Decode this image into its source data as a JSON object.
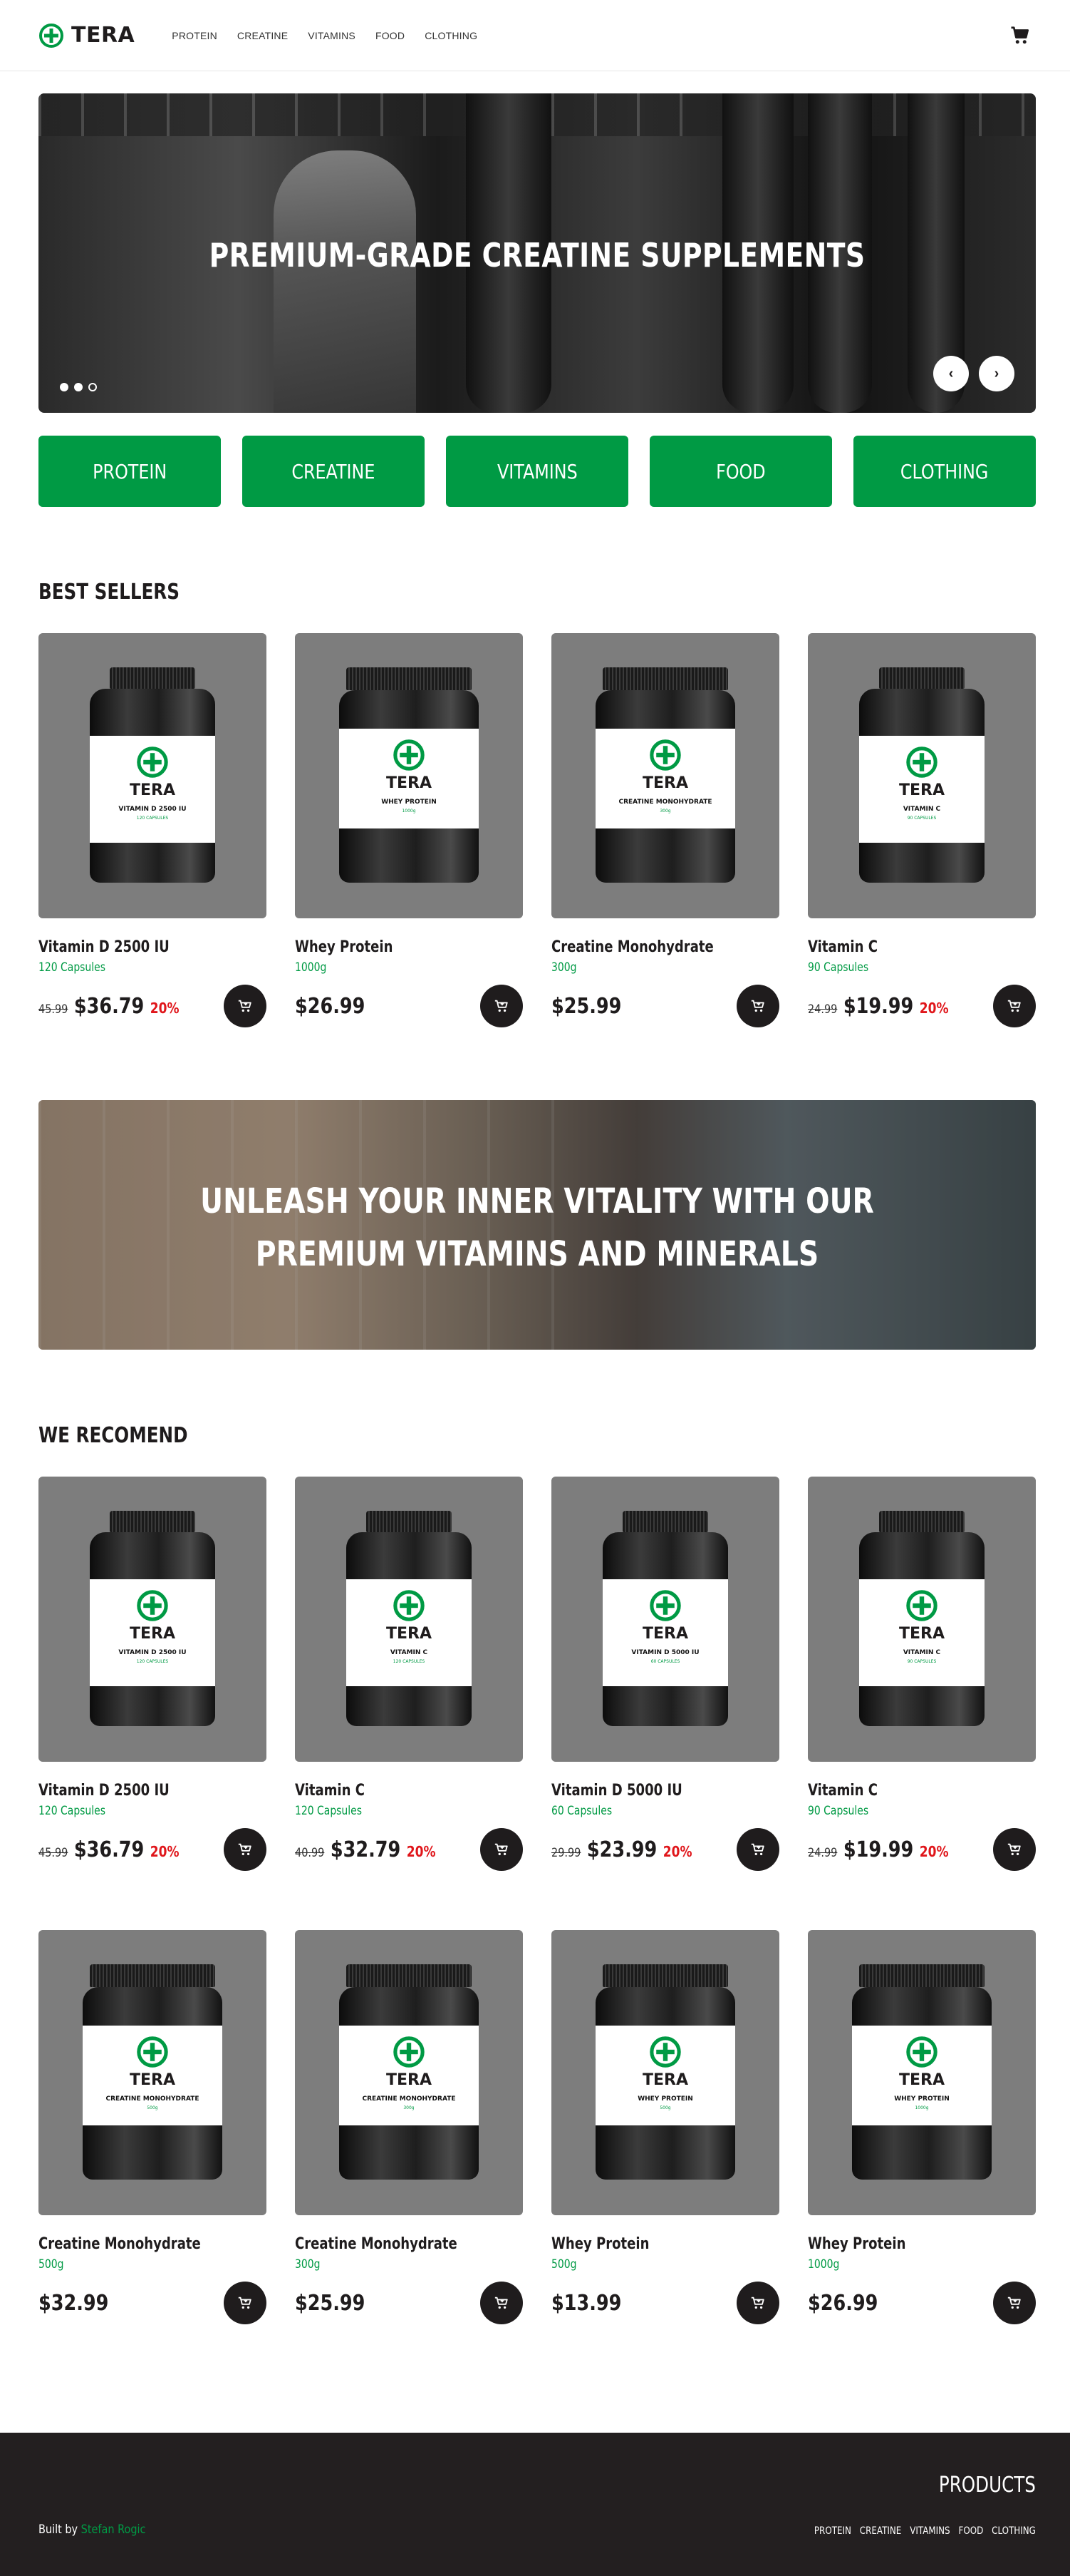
{
  "brand": {
    "name": "TERA",
    "accent": "#009a44",
    "dark": "#1f1c1d",
    "sale_color": "#e0161b"
  },
  "nav": {
    "items": [
      "PROTEIN",
      "CREATINE",
      "VITAMINS",
      "FOOD",
      "CLOTHING"
    ]
  },
  "hero": {
    "title": "PREMIUM-GRADE CREATINE SUPPLEMENTS",
    "slides_count": 3,
    "active_slide": 2,
    "prev_icon": "chevron-left-icon",
    "next_icon": "chevron-right-icon"
  },
  "categories": [
    "PROTEIN",
    "CREATINE",
    "VITAMINS",
    "FOOD",
    "CLOTHING"
  ],
  "best_sellers": {
    "title": "BEST SELLERS",
    "products": [
      {
        "name": "Vitamin D 2500 IU",
        "size": "120 Capsules",
        "old_price": "45.99",
        "price": "$36.79",
        "discount": "20%",
        "label_name": "VITAMIN D 2500 IU",
        "label_size": "120 CAPSULES",
        "jar": "tall"
      },
      {
        "name": "Whey Protein",
        "size": "1000g",
        "old_price": "",
        "price": "$26.99",
        "discount": "",
        "label_name": "WHEY PROTEIN",
        "label_size": "1000g",
        "jar": "wide"
      },
      {
        "name": "Creatine Monohydrate",
        "size": "300g",
        "old_price": "",
        "price": "$25.99",
        "discount": "",
        "label_name": "CREATINE MONOHYDRATE",
        "label_size": "300g",
        "jar": "wide"
      },
      {
        "name": "Vitamin C",
        "size": "90 Capsules",
        "old_price": "24.99",
        "price": "$19.99",
        "discount": "20%",
        "label_name": "VITAMIN C",
        "label_size": "90 CAPSULES",
        "jar": "tall"
      }
    ]
  },
  "banner": {
    "title": "UNLEASH YOUR INNER VITALITY WITH OUR PREMIUM VITAMINS AND MINERALS"
  },
  "recommend": {
    "title": "WE RECOMEND",
    "row1": [
      {
        "name": "Vitamin D 2500 IU",
        "size": "120 Capsules",
        "old_price": "45.99",
        "price": "$36.79",
        "discount": "20%",
        "label_name": "VITAMIN D 2500 IU",
        "label_size": "120 CAPSULES",
        "jar": "tall"
      },
      {
        "name": "Vitamin C",
        "size": "120 Capsules",
        "old_price": "40.99",
        "price": "$32.79",
        "discount": "20%",
        "label_name": "VITAMIN C",
        "label_size": "120 CAPSULES",
        "jar": "tall"
      },
      {
        "name": "Vitamin D 5000 IU",
        "size": "60 Capsules",
        "old_price": "29.99",
        "price": "$23.99",
        "discount": "20%",
        "label_name": "VITAMIN D 5000 IU",
        "label_size": "60 CAPSULES",
        "jar": "tall"
      },
      {
        "name": "Vitamin C",
        "size": "90 Capsules",
        "old_price": "24.99",
        "price": "$19.99",
        "discount": "20%",
        "label_name": "VITAMIN C",
        "label_size": "90 CAPSULES",
        "jar": "tall"
      }
    ],
    "row2": [
      {
        "name": "Creatine Monohydrate",
        "size": "500g",
        "old_price": "",
        "price": "$32.99",
        "discount": "",
        "label_name": "CREATINE MONOHYDRATE",
        "label_size": "500g",
        "jar": "wide"
      },
      {
        "name": "Creatine Monohydrate",
        "size": "300g",
        "old_price": "",
        "price": "$25.99",
        "discount": "",
        "label_name": "CREATINE MONOHYDRATE",
        "label_size": "300g",
        "jar": "wide"
      },
      {
        "name": "Whey Protein",
        "size": "500g",
        "old_price": "",
        "price": "$13.99",
        "discount": "",
        "label_name": "WHEY PROTEIN",
        "label_size": "500g",
        "jar": "wide"
      },
      {
        "name": "Whey Protein",
        "size": "1000g",
        "old_price": "",
        "price": "$26.99",
        "discount": "",
        "label_name": "WHEY PROTEIN",
        "label_size": "1000g",
        "jar": "wide"
      }
    ]
  },
  "footer": {
    "built_prefix": "Built by",
    "author": "Stefan Rogic",
    "title": "PRODUCTS",
    "links": [
      "PROTEIN",
      "CREATINE",
      "VITAMINS",
      "FOOD",
      "CLOTHING"
    ]
  }
}
